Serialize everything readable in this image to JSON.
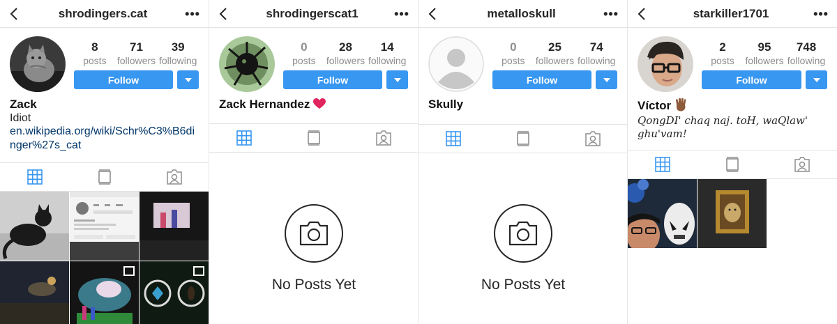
{
  "common": {
    "follow_label": "Follow",
    "posts_label": "posts",
    "followers_label": "followers",
    "following_label": "following",
    "no_posts_text": "No Posts Yet",
    "more_glyph": "•••",
    "accent": "#3897f0"
  },
  "screens": [
    {
      "username": "shrodingers.cat",
      "posts": "8",
      "followers": "71",
      "following": "39",
      "name": "Zack",
      "bio": "Idiot",
      "link": "en.wikipedia.org/wiki/Schr%C3%B6dinger%27s_cat"
    },
    {
      "username": "shrodingerscat1",
      "posts": "0",
      "followers": "28",
      "following": "14",
      "name": "Zack Hernandez",
      "name_emoji": "heart-emoji",
      "no_posts": true
    },
    {
      "username": "metalloskull",
      "posts": "0",
      "followers": "25",
      "following": "74",
      "name": "Skully",
      "no_posts": true
    },
    {
      "username": "starkiller1701",
      "posts": "2",
      "followers": "95",
      "following": "748",
      "name": "Víctor",
      "name_emoji": "vulcan-salute-emoji",
      "bio": "QongDI' chaq naj. toH, waQlaw' ghu'vam!"
    }
  ]
}
